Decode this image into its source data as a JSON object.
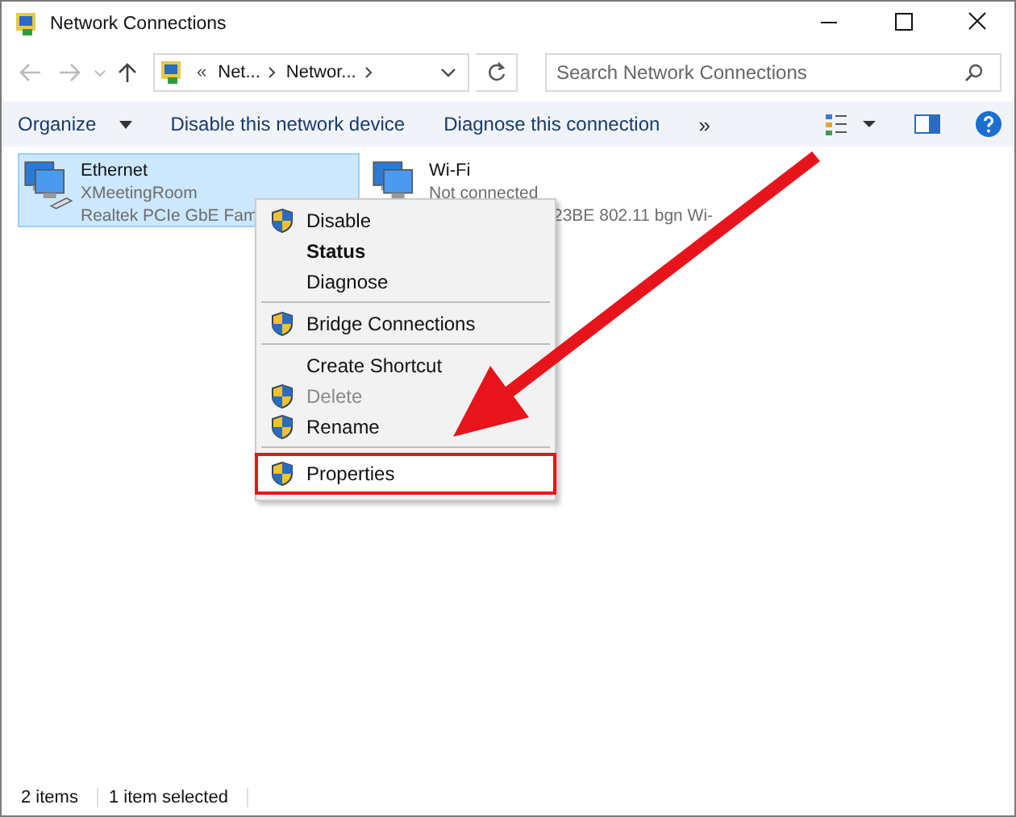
{
  "window": {
    "title": "Network Connections"
  },
  "address_bar": {
    "breadcrumbs": [
      "Net...",
      "Networ..."
    ],
    "overflow": "«"
  },
  "search": {
    "placeholder": "Search Network Connections"
  },
  "toolbar": {
    "items": [
      "Organize",
      "Disable this network device",
      "Diagnose this connection"
    ],
    "more": "»"
  },
  "connections": [
    {
      "name": "Ethernet",
      "status": "XMeetingRoom",
      "device": "Realtek PCIe GbE Fam",
      "selected": true,
      "kind": "wired"
    },
    {
      "name": "Wi-Fi",
      "status": "Not connected",
      "device": "23BE 802.11 bgn Wi-",
      "selected": false,
      "kind": "wireless"
    }
  ],
  "context_menu": [
    {
      "kind": "item",
      "label": "Disable",
      "shield": true,
      "bold": false,
      "disabled": false,
      "highlighted": false
    },
    {
      "kind": "item",
      "label": "Status",
      "shield": false,
      "bold": true,
      "disabled": false,
      "highlighted": false
    },
    {
      "kind": "item",
      "label": "Diagnose",
      "shield": false,
      "bold": false,
      "disabled": false,
      "highlighted": false
    },
    {
      "kind": "separator"
    },
    {
      "kind": "item",
      "label": "Bridge Connections",
      "shield": true,
      "bold": false,
      "disabled": false,
      "highlighted": false
    },
    {
      "kind": "separator"
    },
    {
      "kind": "item",
      "label": "Create Shortcut",
      "shield": false,
      "bold": false,
      "disabled": false,
      "highlighted": false
    },
    {
      "kind": "item",
      "label": "Delete",
      "shield": true,
      "bold": false,
      "disabled": true,
      "highlighted": false
    },
    {
      "kind": "item",
      "label": "Rename",
      "shield": true,
      "bold": false,
      "disabled": false,
      "highlighted": false
    },
    {
      "kind": "separator"
    },
    {
      "kind": "item",
      "label": "Properties",
      "shield": true,
      "bold": false,
      "disabled": false,
      "highlighted": true
    }
  ],
  "status_bar": {
    "items": [
      "2 items",
      "1 item selected"
    ]
  }
}
